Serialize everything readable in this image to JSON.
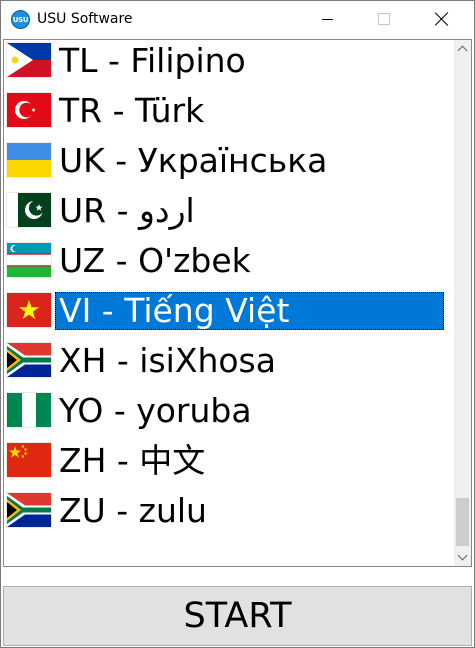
{
  "window": {
    "title": "USU Software",
    "app_icon_text": "USU",
    "icon": "usu-app-icon"
  },
  "languages": {
    "selected_index": 5,
    "items": [
      {
        "label": "TL - Filipino",
        "flag": "ph-flag-icon"
      },
      {
        "label": "TR - Türk",
        "flag": "tr-flag-icon"
      },
      {
        "label": "UK - Українська",
        "flag": "ua-flag-icon"
      },
      {
        "label": "UR - اردو",
        "flag": "pk-flag-icon"
      },
      {
        "label": "UZ - O'zbek",
        "flag": "uz-flag-icon"
      },
      {
        "label": "VI - Tiếng Việt",
        "flag": "vn-flag-icon"
      },
      {
        "label": "XH - isiXhosa",
        "flag": "za-flag-icon"
      },
      {
        "label": "YO - yoruba",
        "flag": "ng-flag-icon"
      },
      {
        "label": "ZH - 中文",
        "flag": "cn-flag-icon"
      },
      {
        "label": "ZU - zulu",
        "flag": "za-flag-icon"
      }
    ]
  },
  "actions": {
    "start_label": "START"
  },
  "colors": {
    "selection": "#0078d7",
    "button_face": "#e1e1e1"
  }
}
